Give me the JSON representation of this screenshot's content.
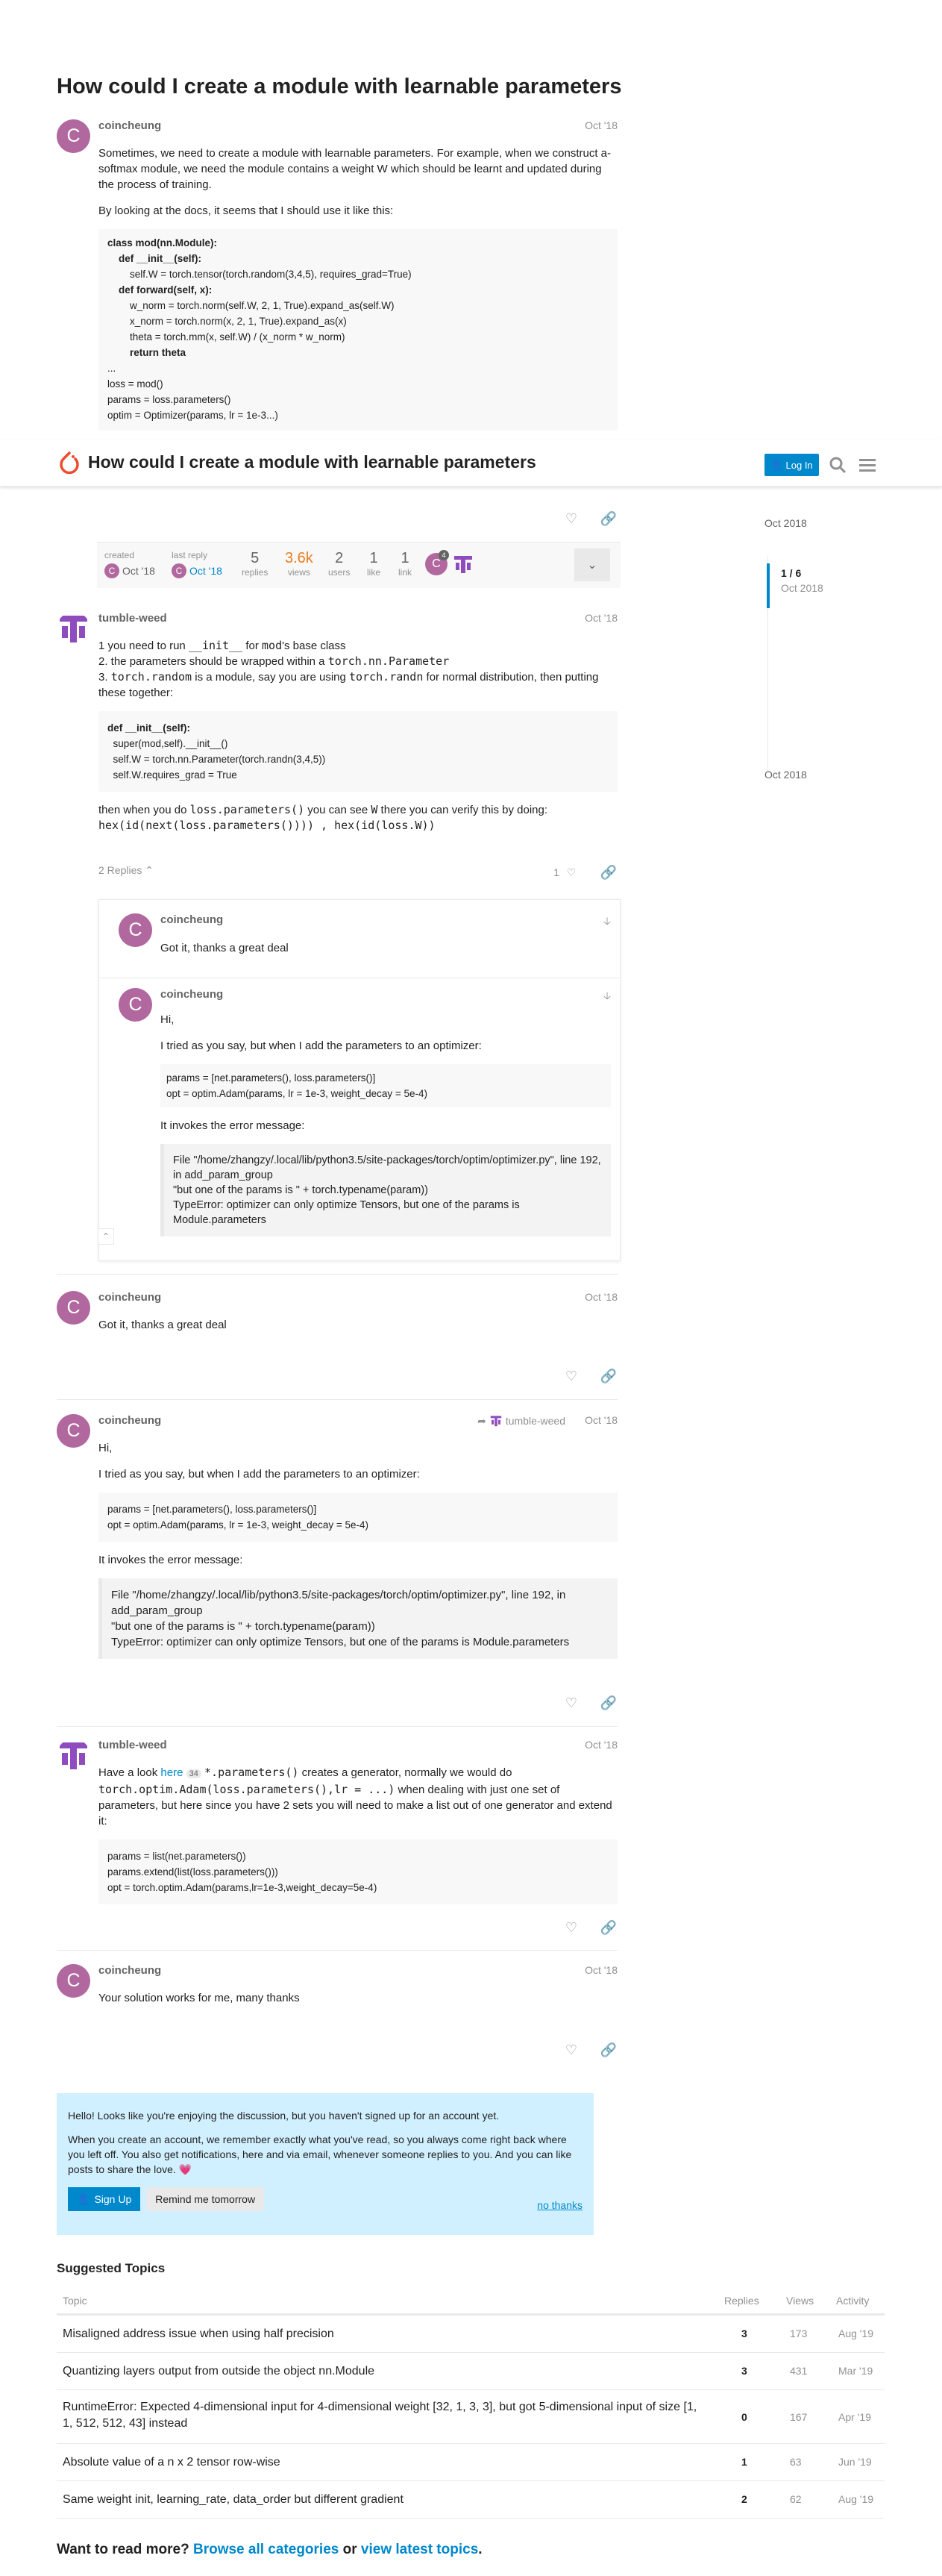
{
  "topic": {
    "title": "How could I create a module with learnable parameters"
  },
  "header": {
    "login_label": "Log In"
  },
  "post1": {
    "author": "coincheung",
    "date": "Oct '18",
    "p1": "Sometimes, we need to create a module with learnable parameters. For example, when we construct a-softmax module, we need the module contains a weight W which should be learnt and updated during the process of training.",
    "p2": "By looking at the docs, it seems that I should use it like this:",
    "code": [
      "class mod(nn.Module):",
      "    def __init__(self):",
      "        self.W = torch.tensor(torch.random(3,4,5), requires_grad=True)",
      "    def forward(self, x):",
      "        w_norm = torch.norm(self.W, 2, 1, True).expand_as(self.W)",
      "        x_norm = torch.norm(x, 2, 1, True).expand_as(x)",
      "        theta = torch.mm(x, self.W) / (x_norm * w_norm)",
      "        return theta",
      "...",
      "loss = mod()",
      "params = loss.parameters()",
      "optim = Optimizer(params, lr = 1e-3...)",
      "..."
    ]
  },
  "topic_map": {
    "created_label": "created",
    "created_date": "Oct '18",
    "last_reply_label": "last reply",
    "last_reply_date": "Oct '18",
    "replies_val": "5",
    "replies_label": "replies",
    "views_val": "3.6k",
    "views_label": "views",
    "users_val": "2",
    "users_label": "users",
    "like_val": "1",
    "like_label": "like",
    "link_val": "1",
    "link_label": "link",
    "avatar_badge": "4"
  },
  "timeline": {
    "top_date": "Oct 2018",
    "position": "1 / 6",
    "pos_date": "Oct 2018",
    "bottom_date": "Oct 2018"
  },
  "post2": {
    "author": "tumble-weed",
    "date": "Oct '18",
    "l1a": "1 you need to run ",
    "l1code": "__init__",
    "l1b": " for ",
    "l1code2": "mod",
    "l1c": "'s base class",
    "l2a": "2. the parameters should be wrapped within a ",
    "l2code": "torch.nn.Parameter",
    "l3a": "3. ",
    "l3code": "torch.random",
    "l3b": " is a module, say you are using ",
    "l3code2": "torch.randn",
    "l3c": " for normal distribution, then putting these together:",
    "code": [
      "def __init__(self):",
      "  super(mod,self).__init__()",
      "  self.W = torch.nn.Parameter(torch.randn(3,4,5))",
      "  self.W.requires_grad = True"
    ],
    "after_a": "then when you do ",
    "after_code": "loss.parameters()",
    "after_b": " you can see ",
    "after_code2": "W",
    "after_c": " there you can verify this by doing:",
    "after_code3": "hex(id(next(loss.parameters()))) , hex(id(loss.W))",
    "replies_label": "2 Replies",
    "like_count": "1"
  },
  "nested": {
    "r1_author": "coincheung",
    "r1_text": "Got it, thanks a great deal",
    "r2_author": "coincheung",
    "r2_hi": "Hi,",
    "r2_p1": "I tried as you say, but when I add the parameters to an optimizer:",
    "r2_code": [
      "params = [net.parameters(), loss.parameters()]",
      "opt = optim.Adam(params, lr = 1e-3, weight_decay = 5e-4)"
    ],
    "r2_p2": "It invokes the error message:",
    "r2_quote": [
      "File \"/home/zhangzy/.local/lib/python3.5/site-packages/torch/optim/optimizer.py\", line 192, in add_param_group",
      "\"but one of the params is \" + torch.typename(param))",
      "TypeError: optimizer can only optimize Tensors, but one of the params is Module.parameters"
    ]
  },
  "post3": {
    "author": "coincheung",
    "date": "Oct '18",
    "text": "Got it, thanks a great deal"
  },
  "post4": {
    "author": "coincheung",
    "reply_to": "tumble-weed",
    "date": "Oct '18",
    "hi": "Hi,",
    "p1": "I tried as you say, but when I add the parameters to an optimizer:",
    "code": [
      "params = [net.parameters(), loss.parameters()]",
      "opt = optim.Adam(params, lr = 1e-3, weight_decay = 5e-4)"
    ],
    "p2": "It invokes the error message:",
    "quote": [
      "File \"/home/zhangzy/.local/lib/python3.5/site-packages/torch/optim/optimizer.py\", line 192, in add_param_group",
      "\"but one of the params is \" + torch.typename(param))",
      "TypeError: optimizer can only optimize Tensors, but one of the params is Module.parameters"
    ]
  },
  "post5": {
    "author": "tumble-weed",
    "date": "Oct '18",
    "t_a": "Have a look ",
    "t_link": "here",
    "t_count": "34",
    "t_code": "*.parameters()",
    "t_b": " creates a generator, normally we would do ",
    "t_code2": "torch.optim.Adam(loss.parameters(),lr = ...)",
    "t_c": " when dealing with just one set of parameters, but here since you have 2 sets you will need to make a list out of one generator and extend it:",
    "code": [
      "params = list(net.parameters())",
      "params.extend(list(loss.parameters()))",
      "opt = torch.optim.Adam(params,lr=1e-3,weight_decay=5e-4)"
    ]
  },
  "post6": {
    "author": "coincheung",
    "date": "Oct '18",
    "text": "Your solution works for me, many thanks"
  },
  "signup": {
    "line1": "Hello! Looks like you're enjoying the discussion, but you haven't signed up for an account yet.",
    "line2": "When you create an account, we remember exactly what you've read, so you always come right back where you left off. You also get notifications, here and via email, whenever someone replies to you. And you can like posts to share the love.",
    "heart": "💗",
    "signup_label": "Sign Up",
    "remind_label": "Remind me tomorrow",
    "nothanks_label": "no thanks"
  },
  "suggested": {
    "heading": "Suggested Topics",
    "col_topic": "Topic",
    "col_replies": "Replies",
    "col_views": "Views",
    "col_activity": "Activity",
    "rows": [
      {
        "title": "Misaligned address issue when using half precision",
        "replies": "3",
        "views": "173",
        "activity": "Aug '19"
      },
      {
        "title": "Quantizing layers output from outside the object nn.Module",
        "replies": "3",
        "views": "431",
        "activity": "Mar '19"
      },
      {
        "title": "RuntimeError: Expected 4-dimensional input for 4-dimensional weight [32, 1, 3, 3], but got 5-dimensional input of size [1, 1, 512, 512, 43] instead",
        "replies": "0",
        "views": "167",
        "activity": "Apr '19"
      },
      {
        "title": "Absolute value of a n x 2 tensor row-wise",
        "replies": "1",
        "views": "63",
        "activity": "Jun '19"
      },
      {
        "title": "Same weight init, learning_rate, data_order but different gradient",
        "replies": "2",
        "views": "62",
        "activity": "Aug '19"
      }
    ]
  },
  "footer": {
    "want": "Want to read more? ",
    "browse": "Browse all categories",
    "or": " or ",
    "view": "view latest topics",
    "dot": "."
  },
  "colors": {
    "accent": "#0088cc",
    "avatar_c": "#b1689e",
    "avatar_t": "#8f4cbf",
    "signup_bg": "#d1f0ff"
  }
}
